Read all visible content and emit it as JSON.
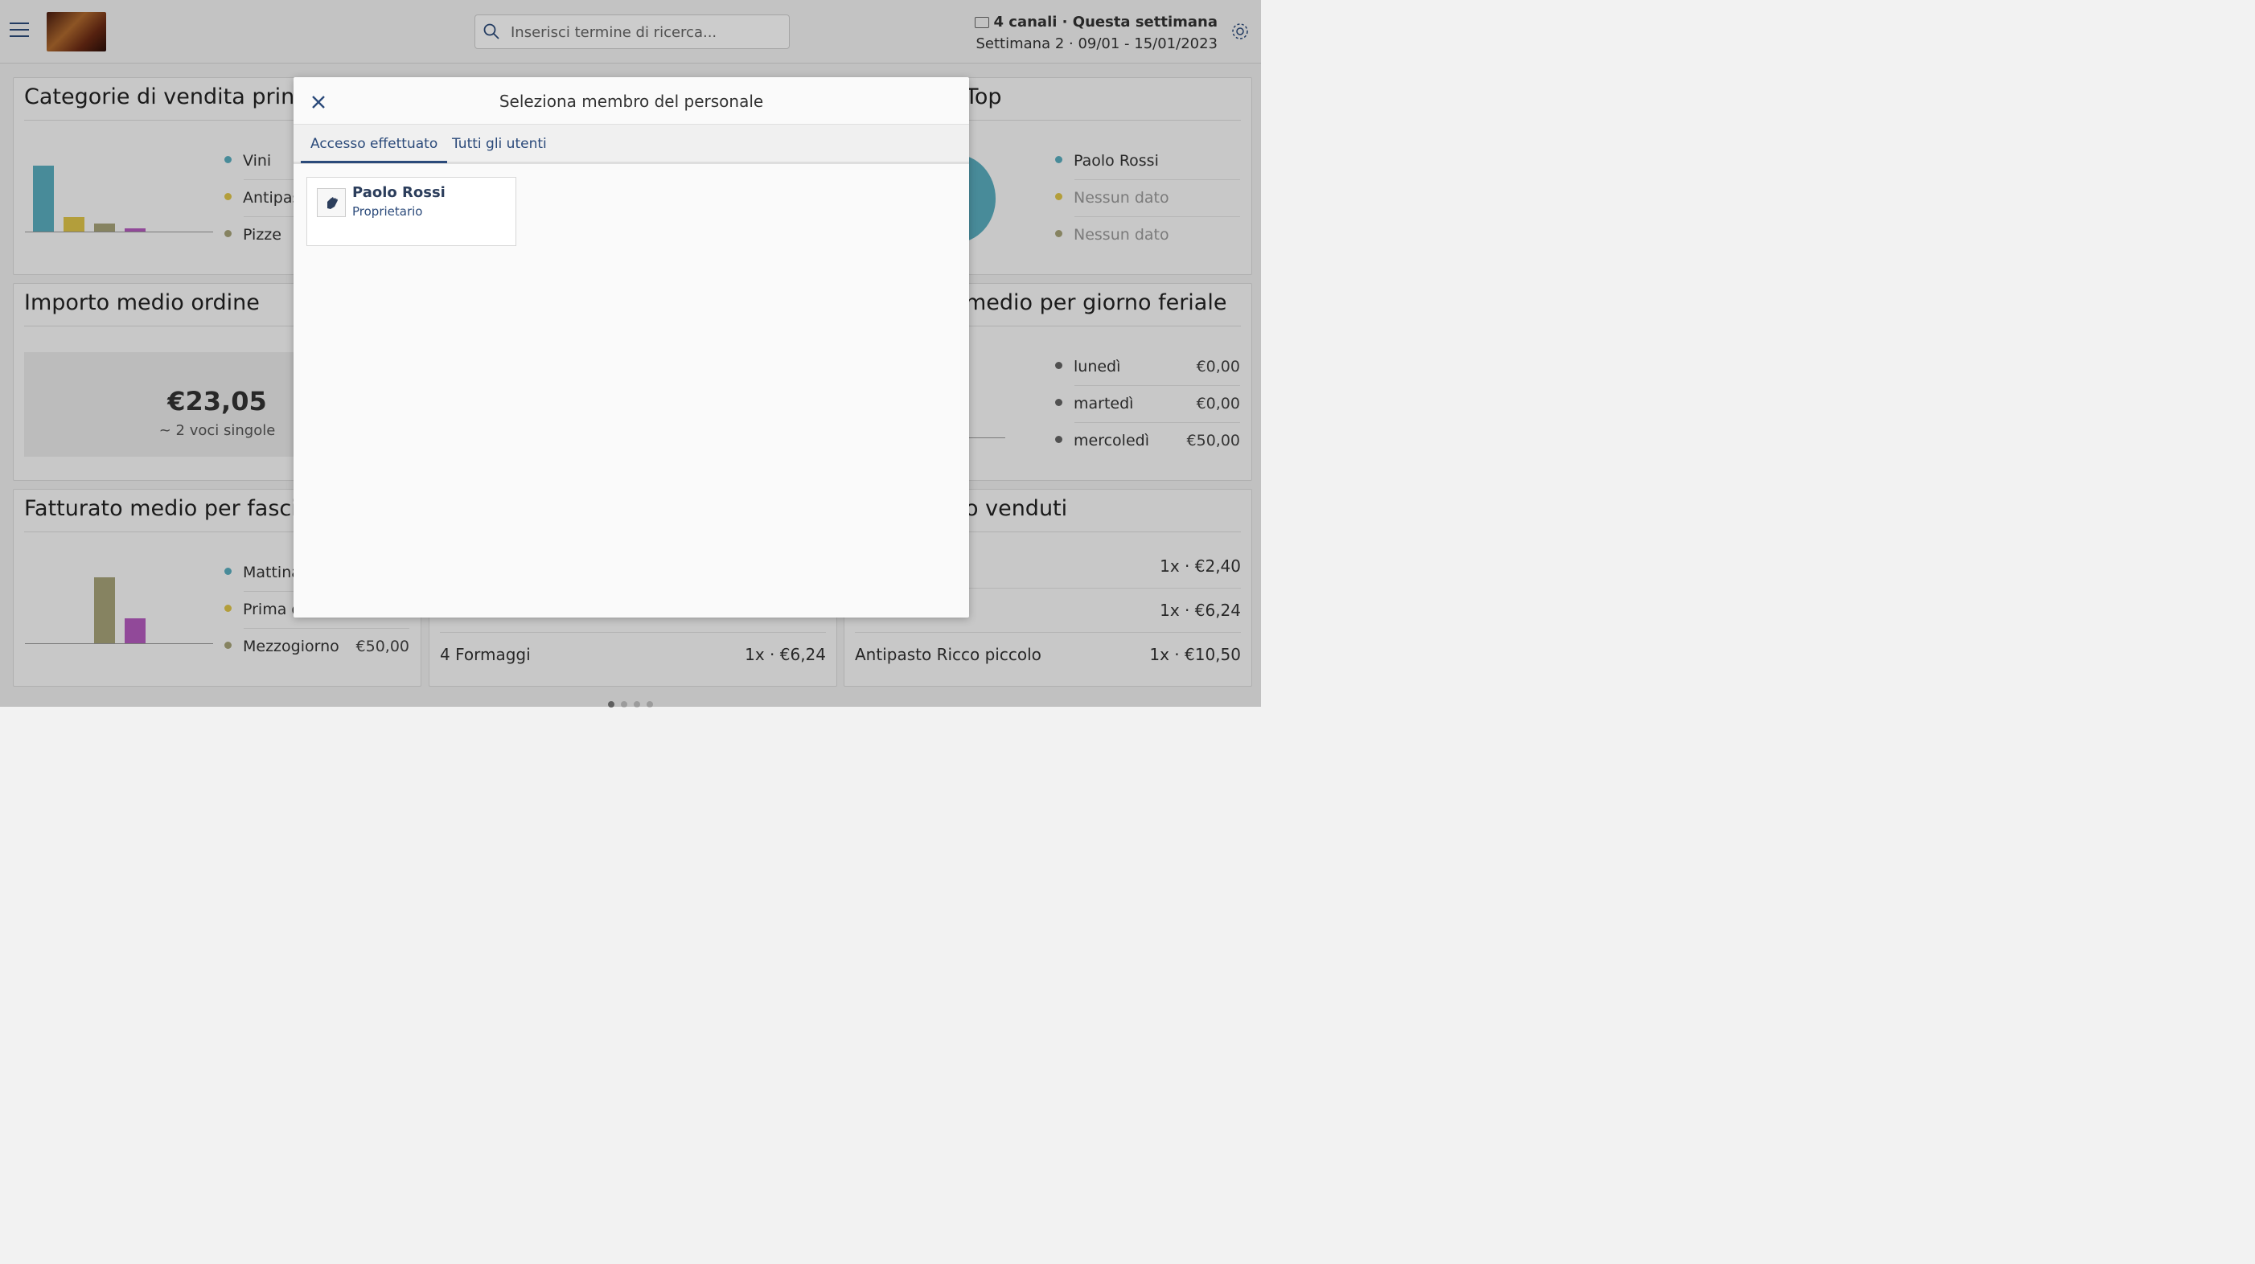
{
  "header": {
    "search_placeholder": "Inserisci termine di ricerca...",
    "channels_label": "4 canali · Questa settimana",
    "week_label": "Settimana 2 · 09/01 - 15/01/2023"
  },
  "cards": {
    "categories": {
      "title": "Categorie di vendita principali",
      "legend": [
        {
          "label": "Vini",
          "color": "#5aaec0"
        },
        {
          "label": "Antipasti",
          "color": "#e0c64a"
        },
        {
          "label": "Pizze",
          "color": "#a8a47a"
        }
      ],
      "chart_data": {
        "type": "bar",
        "categories": [
          "Vini",
          "Antipasti",
          "Pizze",
          ""
        ],
        "values": [
          100,
          22,
          12,
          5
        ]
      }
    },
    "top_staff": {
      "title": "Top",
      "legend": [
        {
          "label": "Paolo Rossi",
          "color": "#5aaec0"
        },
        {
          "label": "Nessun dato",
          "color": "#e0c64a"
        },
        {
          "label": "Nessun dato",
          "color": "#a8a47a"
        }
      ]
    },
    "avg_order": {
      "title": "Importo medio ordine",
      "amount": "€23,05",
      "sub": "~ 2 voci singole"
    },
    "weekday": {
      "title": "medio per giorno feriale",
      "rows": [
        {
          "label": "lunedì",
          "value": "€0,00"
        },
        {
          "label": "martedì",
          "value": "€0,00"
        },
        {
          "label": "mercoledì",
          "value": "€50,00"
        }
      ]
    },
    "hourly": {
      "title": "Fatturato medio per fascia oraria",
      "legend": [
        {
          "label": "Mattina",
          "color": "#5aaec0"
        },
        {
          "label": "Prima di pranzo",
          "color": "#e0c64a"
        },
        {
          "label": "Mezzogiorno",
          "color": "#a8a47a",
          "value": "€50,00"
        }
      ],
      "chart_data": {
        "type": "bar",
        "categories": [
          "",
          "",
          "",
          ""
        ],
        "values": [
          0,
          0,
          100,
          38
        ]
      }
    },
    "middle_bottom": {
      "rows": [
        {
          "label": "4 Formaggi",
          "value": "1x · €6,24"
        }
      ]
    },
    "sold": {
      "title": "o venduti",
      "rows": [
        {
          "label": "",
          "value": "1x · €2,40"
        },
        {
          "label": "",
          "value": "1x · €6,24"
        },
        {
          "label": "Antipasto Ricco piccolo",
          "value": "1x · €10,50"
        }
      ]
    }
  },
  "modal": {
    "title": "Seleziona membro del personale",
    "tabs": [
      "Accesso effettuato",
      "Tutti gli utenti"
    ],
    "staff": [
      {
        "name": "Paolo Rossi",
        "role": "Proprietario"
      }
    ]
  }
}
